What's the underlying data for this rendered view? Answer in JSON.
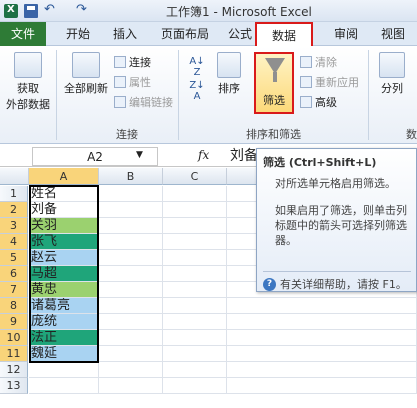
{
  "window": {
    "title": "工作簿1 - Microsoft Excel"
  },
  "qat": {
    "undo": "↶",
    "redo": "↷"
  },
  "ribbon_tabs": [
    "文件",
    "开始",
    "插入",
    "页面布局",
    "公式",
    "数据",
    "审阅",
    "视图"
  ],
  "ribbon": {
    "get_external": [
      "获取",
      "外部数据"
    ],
    "refresh_all": "全部刷新",
    "connections": "连接",
    "properties": "属性",
    "edit_links": "编辑链接",
    "group_connections": "连接",
    "sort": "排序",
    "filter": "筛选",
    "clear": "清除",
    "reapply": "重新应用",
    "advanced": "高级",
    "group_sort_filter": "排序和筛选",
    "split": "分列",
    "group_cut": "数"
  },
  "formula_bar": {
    "namebox": "A2",
    "fx": "fx",
    "value": "刘备"
  },
  "grid": {
    "columns": [
      "A",
      "B",
      "C"
    ],
    "rows": [
      "1",
      "2",
      "3",
      "4",
      "5",
      "6",
      "7",
      "8",
      "9",
      "10",
      "11",
      "12",
      "13"
    ],
    "cells": [
      "姓名",
      "刘备",
      "关羽",
      "张飞",
      "赵云",
      "马超",
      "黄忠",
      "诸葛亮",
      "庞统",
      "法正",
      "魏延"
    ],
    "cell_colors": [
      "#ffffff",
      "#ffffff",
      "#9bd16f",
      "#1fa57a",
      "#a9d3f2",
      "#1fa57a",
      "#9bd16f",
      "#a9d3f2",
      "#a9d3f2",
      "#1fa57a",
      "#a9d3f2"
    ]
  },
  "tooltip": {
    "title": "筛选 (Ctrl+Shift+L)",
    "body1": "对所选单元格启用筛选。",
    "body2": "如果启用了筛选，则单击列标题中的箭头可选择列筛选器。",
    "footer": "有关详细帮助，请按 F1。"
  }
}
